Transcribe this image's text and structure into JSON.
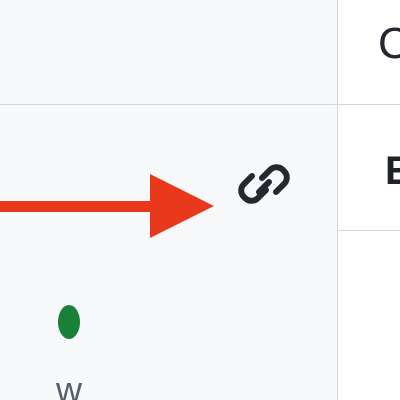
{
  "colors": {
    "pane_background": "#f6f8fa",
    "sidebar_background": "#ffffff",
    "divider": "#d0d7de",
    "annotation_arrow": "#e8391d",
    "icon": "#24292f",
    "status_green": "#1a7f37"
  },
  "main": {
    "link_button": {
      "icon": "link-icon"
    },
    "annotation": {
      "icon": "arrow-right-icon",
      "color": "#e8391d"
    }
  },
  "sidebar": {
    "top_glyph": "C",
    "section_heading": "E",
    "bottom_glyph": "w",
    "status_icon": "status-dot-icon"
  }
}
